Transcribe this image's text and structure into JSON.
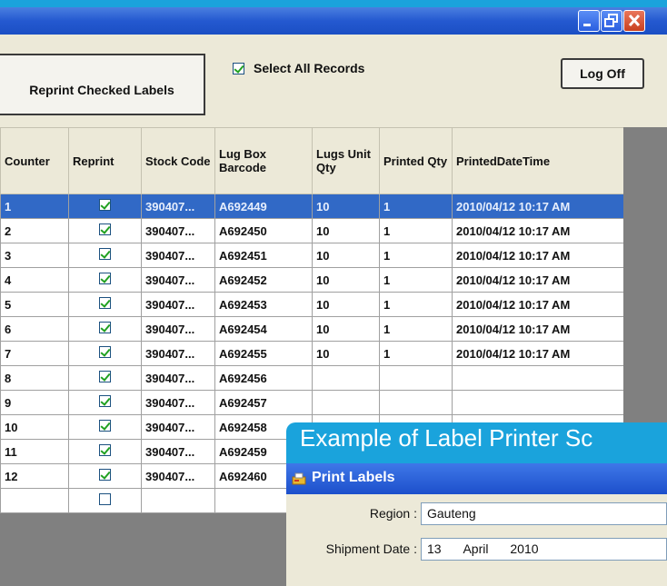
{
  "window": {
    "minimize_icon": "minimize-icon",
    "restore_icon": "restore-icon",
    "close_icon": "close-icon"
  },
  "toolbar": {
    "reprint_label": "Reprint Checked Labels",
    "select_all_label": "Select All Records",
    "select_all_checked": true,
    "logoff_label": "Log Off"
  },
  "grid": {
    "columns": [
      "Counter",
      "Reprint",
      "Stock Code",
      "Lug Box Barcode",
      "Lugs Unit Qty",
      "Printed Qty",
      "PrintedDateTime"
    ],
    "rows": [
      {
        "counter": "1",
        "reprint": true,
        "stock": "390407...",
        "barcode": "A692449",
        "lugs": "10",
        "printed": "1",
        "datetime": "2010/04/12 10:17 AM"
      },
      {
        "counter": "2",
        "reprint": true,
        "stock": "390407...",
        "barcode": "A692450",
        "lugs": "10",
        "printed": "1",
        "datetime": "2010/04/12 10:17 AM"
      },
      {
        "counter": "3",
        "reprint": true,
        "stock": "390407...",
        "barcode": "A692451",
        "lugs": "10",
        "printed": "1",
        "datetime": "2010/04/12 10:17 AM"
      },
      {
        "counter": "4",
        "reprint": true,
        "stock": "390407...",
        "barcode": "A692452",
        "lugs": "10",
        "printed": "1",
        "datetime": "2010/04/12 10:17 AM"
      },
      {
        "counter": "5",
        "reprint": true,
        "stock": "390407...",
        "barcode": "A692453",
        "lugs": "10",
        "printed": "1",
        "datetime": "2010/04/12 10:17 AM"
      },
      {
        "counter": "6",
        "reprint": true,
        "stock": "390407...",
        "barcode": "A692454",
        "lugs": "10",
        "printed": "1",
        "datetime": "2010/04/12 10:17 AM"
      },
      {
        "counter": "7",
        "reprint": true,
        "stock": "390407...",
        "barcode": "A692455",
        "lugs": "10",
        "printed": "1",
        "datetime": "2010/04/12 10:17 AM"
      },
      {
        "counter": "8",
        "reprint": true,
        "stock": "390407...",
        "barcode": "A692456",
        "lugs": "",
        "printed": "",
        "datetime": ""
      },
      {
        "counter": "9",
        "reprint": true,
        "stock": "390407...",
        "barcode": "A692457",
        "lugs": "",
        "printed": "",
        "datetime": ""
      },
      {
        "counter": "10",
        "reprint": true,
        "stock": "390407...",
        "barcode": "A692458",
        "lugs": "",
        "printed": "",
        "datetime": ""
      },
      {
        "counter": "11",
        "reprint": true,
        "stock": "390407...",
        "barcode": "A692459",
        "lugs": "",
        "printed": "",
        "datetime": ""
      },
      {
        "counter": "12",
        "reprint": true,
        "stock": "390407...",
        "barcode": "A692460",
        "lugs": "",
        "printed": "",
        "datetime": ""
      },
      {
        "counter": "",
        "reprint": false,
        "stock": "",
        "barcode": "",
        "lugs": "",
        "printed": "",
        "datetime": ""
      }
    ],
    "selected_row": 0
  },
  "caption": "Example of Label Printer Sc",
  "print_labels": {
    "title": "Print Labels",
    "region_label": "Region :",
    "region_value": "Gauteng",
    "shipment_label": "Shipment Date :",
    "date_day": "13",
    "date_month": "April",
    "date_year": "2010"
  },
  "colors": {
    "frame_blue": "#1aa3dc",
    "title_blue": "#2459d0",
    "selection": "#3169c6",
    "check_green": "#21a121"
  }
}
